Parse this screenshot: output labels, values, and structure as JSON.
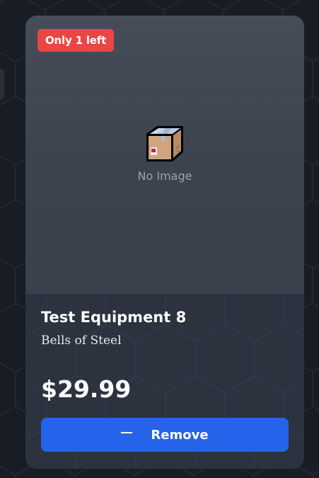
{
  "product": {
    "stock_badge": "Only 1 left",
    "image_placeholder_icon": "package-icon",
    "image_placeholder_text": "No Image",
    "title": "Test Equipment 8",
    "brand": "Bells of Steel",
    "price": "$29.99",
    "remove_button": {
      "label": "Remove",
      "icon": "minus-icon"
    }
  },
  "colors": {
    "badge": "#ea4646",
    "button": "#2563eb",
    "card": "#2c323e",
    "page_bg": "#181c25"
  }
}
